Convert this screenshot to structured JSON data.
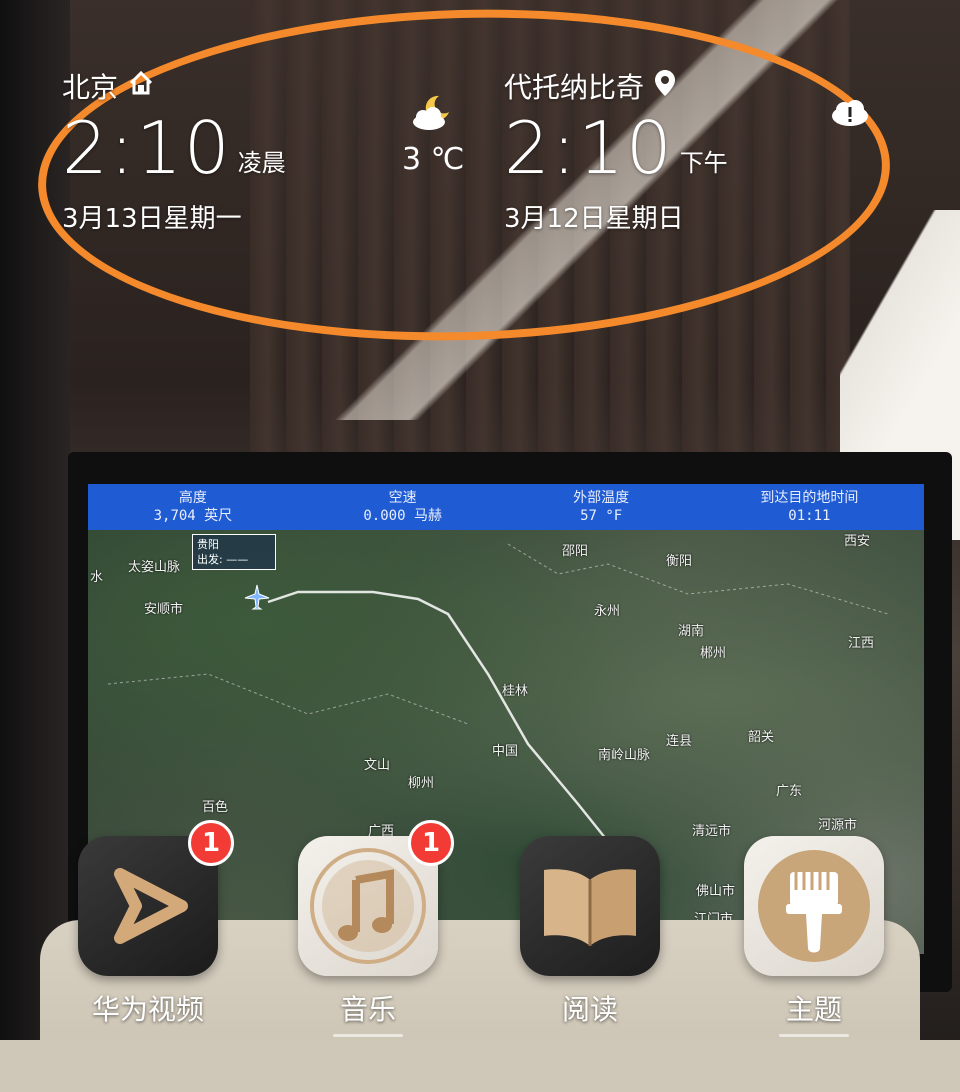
{
  "clock_left": {
    "city": "北京",
    "city_icon": "home-icon",
    "time": "2:10",
    "period": "凌晨",
    "date": "3月13日星期一"
  },
  "weather": {
    "icon": "moon-cloud-icon",
    "temperature": "3 ℃"
  },
  "clock_right": {
    "city": "代托纳比奇",
    "city_icon": "location-pin-icon",
    "time": "2:10",
    "period": "下午",
    "date": "3月12日星期日",
    "status_icon": "warning-cloud-icon"
  },
  "inflight_map": {
    "stats": [
      {
        "label": "高度",
        "value": "3,704 英尺"
      },
      {
        "label": "空速",
        "value": "0.000 马赫"
      },
      {
        "label": "外部温度",
        "value": "57 °F"
      },
      {
        "label": "到达目的地时间",
        "value": "01:11"
      }
    ],
    "origin": {
      "city": "贵阳",
      "status": "出发: ——"
    },
    "places": [
      "安顺市",
      "太姿山脉",
      "水",
      "中国",
      "桂林",
      "文山",
      "柳州",
      "广西",
      "百色",
      "湖南",
      "郴州",
      "衡阳",
      "邵阳",
      "永州",
      "江西",
      "连县",
      "韶关",
      "广东",
      "河源市",
      "清远市",
      "佛山市",
      "江门市",
      "南岭山脉",
      "西安"
    ]
  },
  "dock": [
    {
      "label": "华为视频",
      "icon": "huawei-video-icon",
      "badge": "1"
    },
    {
      "label": "音乐",
      "icon": "music-icon",
      "badge": "1"
    },
    {
      "label": "阅读",
      "icon": "book-icon",
      "badge": ""
    },
    {
      "label": "主题",
      "icon": "theme-brush-icon",
      "badge": ""
    }
  ],
  "colors": {
    "annotation": "#f48a2c",
    "badge": "#f23b34",
    "map_bar": "#1f5bd3"
  }
}
